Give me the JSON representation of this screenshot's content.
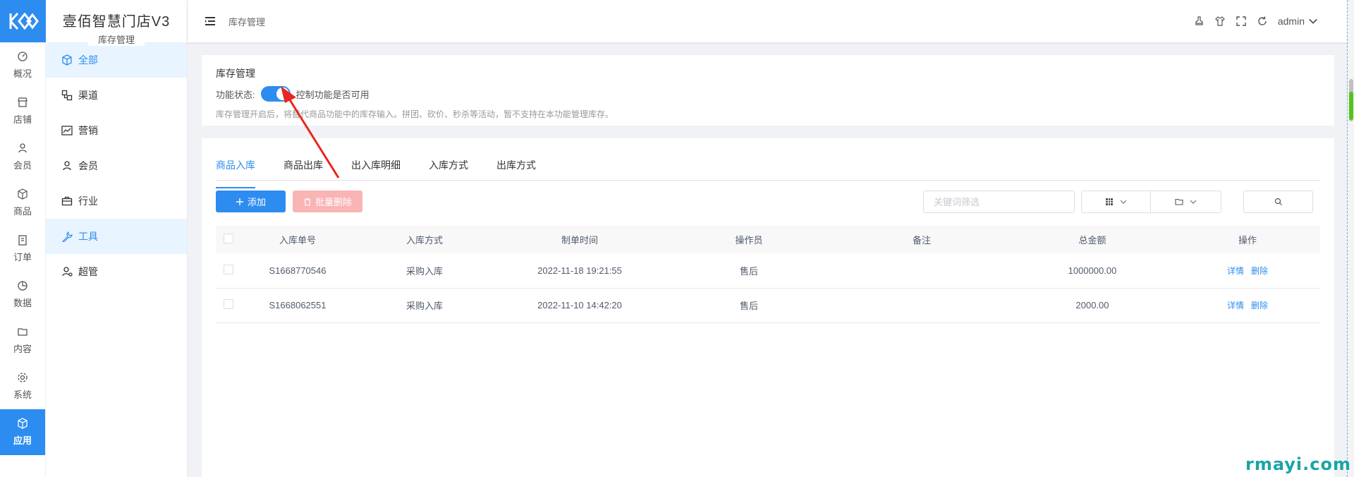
{
  "app": {
    "name": "壹佰智慧门店V3",
    "module": "库存管理"
  },
  "rail": {
    "items": [
      {
        "label": "概况",
        "icon": "dashboard-icon"
      },
      {
        "label": "店铺",
        "icon": "shop-icon"
      },
      {
        "label": "会员",
        "icon": "user-icon"
      },
      {
        "label": "商品",
        "icon": "box-icon"
      },
      {
        "label": "订单",
        "icon": "clipboard-icon"
      },
      {
        "label": "数据",
        "icon": "pie-chart-icon"
      },
      {
        "label": "内容",
        "icon": "folder-icon"
      },
      {
        "label": "系统",
        "icon": "gear-icon"
      },
      {
        "label": "应用",
        "icon": "cube-icon",
        "active": true
      }
    ]
  },
  "submenu": {
    "items": [
      {
        "label": "全部",
        "icon": "cube-icon",
        "active": true
      },
      {
        "label": "渠道",
        "icon": "channel-icon"
      },
      {
        "label": "营销",
        "icon": "chart-line-icon"
      },
      {
        "label": "会员",
        "icon": "user-icon"
      },
      {
        "label": "行业",
        "icon": "briefcase-icon"
      },
      {
        "label": "工具",
        "icon": "wrench-icon",
        "active": true
      },
      {
        "label": "超管",
        "icon": "admin-user-icon"
      }
    ]
  },
  "header": {
    "breadcrumb": "库存管理",
    "user": "admin"
  },
  "settings": {
    "title": "库存管理",
    "status_label": "功能状态:",
    "switch_on": true,
    "switch_desc": "控制功能是否可用",
    "hint": "库存管理开启后，将替代商品功能中的库存输入。拼团、砍价、秒杀等活动，暂不支持在本功能管理库存。"
  },
  "tabs": [
    "商品入库",
    "商品出库",
    "出入库明细",
    "入库方式",
    "出库方式"
  ],
  "toolbar": {
    "add_label": "添加",
    "batch_delete_label": "批量删除",
    "search_placeholder": "关键词筛选"
  },
  "table": {
    "columns": [
      "入库单号",
      "入库方式",
      "制单时间",
      "操作员",
      "备注",
      "总金额",
      "操作"
    ],
    "rows": [
      {
        "no": "S1668770546",
        "method": "采购入库",
        "time": "2022-11-18 19:21:55",
        "operator": "售后",
        "note": "",
        "amount": "1000000.00"
      },
      {
        "no": "S1668062551",
        "method": "采购入库",
        "time": "2022-11-10 14:42:20",
        "operator": "售后",
        "note": "",
        "amount": "2000.00"
      }
    ],
    "action_detail": "详情",
    "action_delete": "删除"
  },
  "watermark": "rmayi.com",
  "colors": {
    "primary": "#2d8cf0",
    "danger_light": "#f9b4b4",
    "annotation_arrow": "#e8261f"
  }
}
